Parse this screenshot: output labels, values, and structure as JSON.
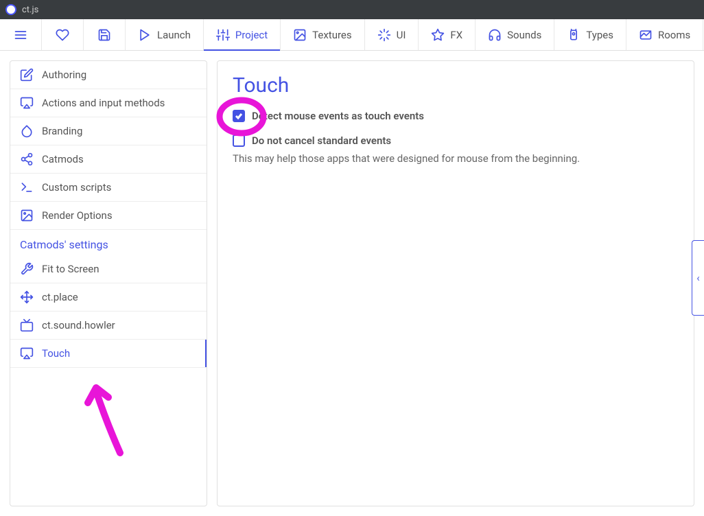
{
  "window": {
    "title": "ct.js"
  },
  "toolbar": {
    "launch": "Launch",
    "project": "Project",
    "textures": "Textures",
    "ui": "UI",
    "fx": "FX",
    "sounds": "Sounds",
    "types": "Types",
    "rooms": "Rooms"
  },
  "sidebar": {
    "items": [
      "Authoring",
      "Actions and input methods",
      "Branding",
      "Catmods",
      "Custom scripts",
      "Render Options"
    ],
    "section_title": "Catmods' settings",
    "mods": [
      "Fit to Screen",
      "ct.place",
      "ct.sound.howler",
      "Touch"
    ]
  },
  "panel": {
    "title": "Touch",
    "opt_detect": "Detect mouse events as touch events",
    "opt_nocancel": "Do not cancel standard events",
    "help": "This may help those apps that were designed for mouse from the beginning."
  },
  "drawer_glyph": "‹"
}
